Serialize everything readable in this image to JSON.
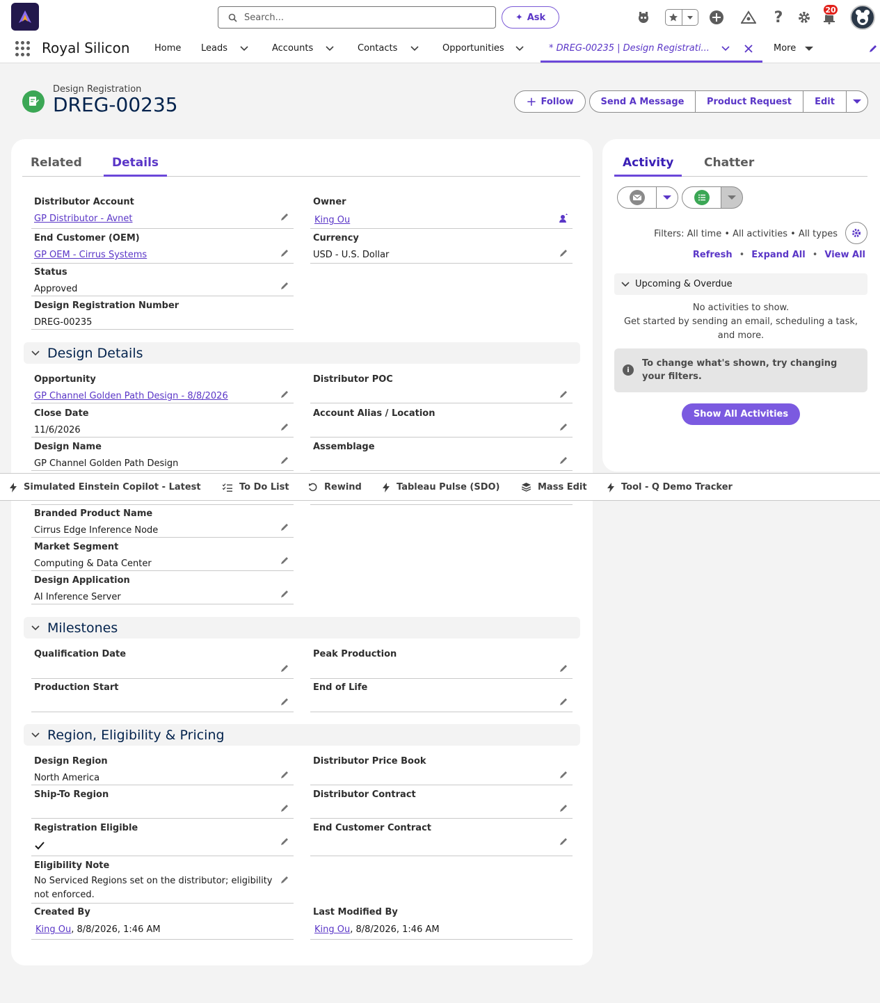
{
  "global_header": {
    "search_placeholder": "Search...",
    "ask_label": "Ask",
    "notification_count": "20"
  },
  "nav": {
    "app_name": "Royal Silicon",
    "items": [
      {
        "label": "Home"
      },
      {
        "label": "Leads"
      },
      {
        "label": "Accounts"
      },
      {
        "label": "Contacts"
      },
      {
        "label": "Opportunities"
      }
    ],
    "active_tab": "* DREG-00235 | Design Registrati...",
    "more_label": "More"
  },
  "record": {
    "type": "Design Registration",
    "name": "DREG-00235",
    "actions": {
      "follow": "Follow",
      "send_message": "Send A Message",
      "product_request": "Product Request",
      "edit": "Edit"
    }
  },
  "detail_tabs": [
    "Related",
    "Details"
  ],
  "fields": {
    "distributor_account": {
      "label": "Distributor Account",
      "value": "GP Distributor - Avnet"
    },
    "owner": {
      "label": "Owner",
      "value": "King Ou"
    },
    "end_customer": {
      "label": "End Customer (OEM)",
      "value": "GP OEM - Cirrus Systems"
    },
    "currency": {
      "label": "Currency",
      "value": "USD - U.S. Dollar"
    },
    "status": {
      "label": "Status",
      "value": "Approved"
    },
    "dreg_number": {
      "label": "Design Registration Number",
      "value": "DREG-00235"
    },
    "opportunity": {
      "label": "Opportunity",
      "value": "GP Channel Golden Path Design - 8/8/2026"
    },
    "distributor_poc": {
      "label": "Distributor POC",
      "value": ""
    },
    "close_date": {
      "label": "Close Date",
      "value": "11/6/2026"
    },
    "account_alias": {
      "label": "Account Alias / Location",
      "value": ""
    },
    "design_name": {
      "label": "Design Name",
      "value": "GP Channel Golden Path Design"
    },
    "assemblage": {
      "label": "Assemblage",
      "value": ""
    },
    "branded_product": {
      "label": "Branded Product Name",
      "value": "Cirrus Edge Inference Node"
    },
    "market_segment": {
      "label": "Market Segment",
      "value": "Computing & Data Center"
    },
    "design_application": {
      "label": "Design Application",
      "value": "AI Inference Server"
    },
    "qualification_date": {
      "label": "Qualification Date",
      "value": ""
    },
    "peak_production": {
      "label": "Peak Production",
      "value": ""
    },
    "production_start": {
      "label": "Production Start",
      "value": ""
    },
    "end_of_life": {
      "label": "End of Life",
      "value": ""
    },
    "design_region": {
      "label": "Design Region",
      "value": "North America"
    },
    "distributor_price_book": {
      "label": "Distributor Price Book",
      "value": ""
    },
    "ship_to_region": {
      "label": "Ship-To Region",
      "value": ""
    },
    "distributor_contract": {
      "label": "Distributor Contract",
      "value": ""
    },
    "registration_eligible": {
      "label": "Registration Eligible",
      "value": "checked"
    },
    "end_customer_contract": {
      "label": "End Customer Contract",
      "value": ""
    },
    "eligibility_note": {
      "label": "Eligibility Note",
      "value_line1": "No Serviced Regions set on the distributor; eligibility",
      "value_line2": "not enforced."
    },
    "created_by": {
      "label": "Created By",
      "user": "King Ou",
      "date": ", 8/8/2026, 1:46 AM"
    },
    "last_modified_by": {
      "label": "Last Modified By",
      "user": "King Ou",
      "date": ", 8/8/2026, 1:46 AM"
    }
  },
  "sections": {
    "design_details": "Design Details",
    "milestones": "Milestones",
    "region": "Region, Eligibility & Pricing"
  },
  "activity": {
    "tabs": [
      "Activity",
      "Chatter"
    ],
    "filters": "Filters: All time • All activities • All types",
    "links": [
      "Refresh",
      "Expand All",
      "View All"
    ],
    "upcoming": "Upcoming & Overdue",
    "no_activities_line1": "No activities to show.",
    "no_activities_line2": "Get started by sending an email, scheduling a task,",
    "no_activities_line3": "and more.",
    "hint": "To change what's shown, try changing your filters.",
    "show_all": "Show All Activities"
  },
  "utility_bar": [
    {
      "label": "Simulated Einstein Copilot - Latest",
      "icon": "lightning-icon"
    },
    {
      "label": "To Do List",
      "icon": "checklist-icon"
    },
    {
      "label": "Rewind",
      "icon": "rewind-icon"
    },
    {
      "label": "Tableau Pulse (SDO)",
      "icon": "lightning-icon"
    },
    {
      "label": "Mass Edit",
      "icon": "layers-icon"
    },
    {
      "label": "Tool - Q Demo Tracker",
      "icon": "lightning-icon"
    }
  ],
  "colors": {
    "brand": "#5a36c7",
    "accent_button": "#7b5ae0",
    "record_icon": "#3ba755",
    "notification_badge": "#e1201a"
  }
}
